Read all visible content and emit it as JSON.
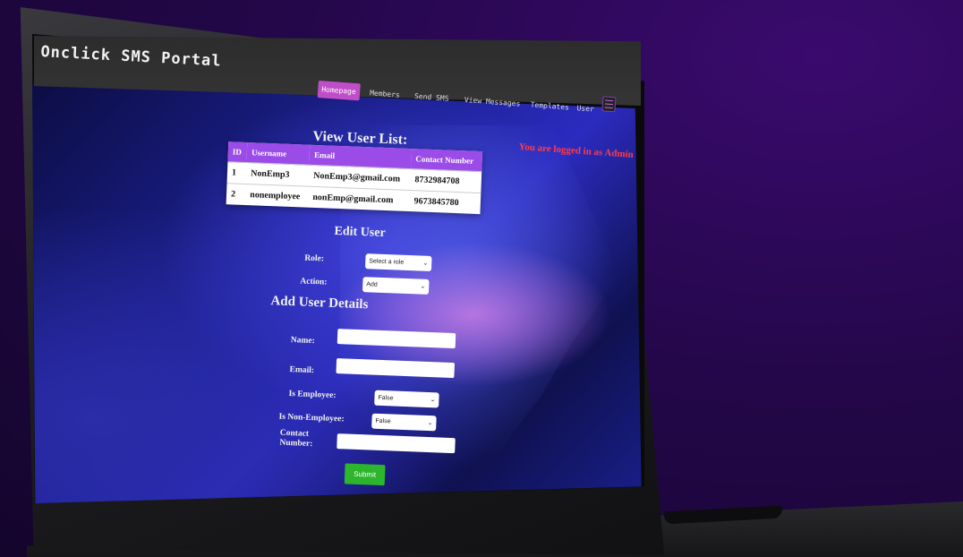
{
  "app": {
    "title": "Onclick SMS Portal"
  },
  "nav": {
    "items": [
      {
        "label": "Homepage",
        "active": true
      },
      {
        "label": "Members",
        "active": false
      },
      {
        "label": "Send SMS",
        "active": false
      },
      {
        "label": "View Messages",
        "active": false
      },
      {
        "label": "Templates",
        "active": false
      },
      {
        "label": "User",
        "active": false
      }
    ]
  },
  "status": {
    "logged_in": "You are logged in as Admin"
  },
  "user_list": {
    "title": "View User List:",
    "columns": [
      "ID",
      "Username",
      "Email",
      "Contact Number"
    ],
    "rows": [
      [
        "1",
        "NonEmp3",
        "NonEmp3@gmail.com",
        "8732984708"
      ],
      [
        "2",
        "nonemployee",
        "nonEmp@gmail.com",
        "9673845780"
      ]
    ]
  },
  "edit_user": {
    "title": "Edit User",
    "role_label": "Role:",
    "role_value": "Select a role",
    "action_label": "Action:",
    "action_value": "Add"
  },
  "add_user": {
    "title": "Add User Details",
    "name_label": "Name:",
    "email_label": "Email:",
    "is_employee_label": "Is Employee:",
    "is_employee_value": "False",
    "is_nonemployee_label": "Is Non-Employee:",
    "is_nonemployee_value": "False",
    "contact_label_1": "Contact",
    "contact_label_2": "Number:",
    "submit_label": "Submit"
  },
  "colors": {
    "accent": "#c04ec8",
    "table_header": "#9b4ce8",
    "submit": "#2db52d",
    "alert": "#ff3b4a"
  }
}
